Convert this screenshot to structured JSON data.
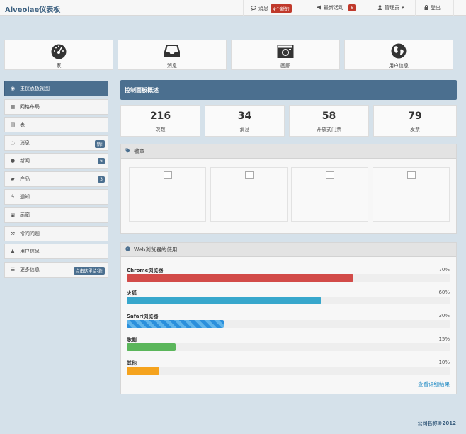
{
  "header": {
    "brand": "Alveolae仪表板",
    "messages_label": "消息",
    "messages_badge": "4个新的",
    "activity_label": "最新活动",
    "activity_badge": "6",
    "admin_label": "管理员",
    "logout_label": "登出"
  },
  "tiles": [
    {
      "icon": "dashboard-icon",
      "label": "家"
    },
    {
      "icon": "inbox-icon",
      "label": "消息"
    },
    {
      "icon": "camera-icon",
      "label": "画廊"
    },
    {
      "icon": "globe-icon",
      "label": "用户信息"
    }
  ],
  "sidebar": {
    "items": [
      {
        "icon": "dashboard-icon",
        "label": "主仪表板视图",
        "badge": ""
      },
      {
        "icon": "grid-icon",
        "label": "网格布局",
        "badge": ""
      },
      {
        "icon": "table-icon",
        "label": "表",
        "badge": ""
      },
      {
        "icon": "comments-icon",
        "label": "消息",
        "badge": "新!"
      },
      {
        "icon": "globe-icon",
        "label": "新闻",
        "badge": "6"
      },
      {
        "icon": "truck-icon",
        "label": "产品",
        "badge": "3"
      },
      {
        "icon": "bolt-icon",
        "label": "通知",
        "badge": ""
      },
      {
        "icon": "picture-icon",
        "label": "画廊",
        "badge": ""
      },
      {
        "icon": "gavel-icon",
        "label": "常问问题",
        "badge": ""
      },
      {
        "icon": "user-icon",
        "label": "用户信息",
        "badge": ""
      },
      {
        "icon": "list-icon",
        "label": "更多信息",
        "badge": "点击这里给我!"
      }
    ]
  },
  "main": {
    "title": "控制面板概述",
    "stats": [
      {
        "value": "216",
        "label": "次数"
      },
      {
        "value": "34",
        "label": "消息"
      },
      {
        "value": "58",
        "label": "开放式门票"
      },
      {
        "value": "79",
        "label": "发票"
      }
    ],
    "badges_title": "徽章",
    "browser_title": "Web浏览器的使用",
    "browsers": [
      {
        "name": "Chrome浏览器",
        "percent": "70%",
        "value": 0.7,
        "color": "#d24b48"
      },
      {
        "name": "火狐",
        "percent": "60%",
        "value": 0.6,
        "color": "#37a7cc"
      },
      {
        "name": "Safari浏览器",
        "percent": "30%",
        "value": 0.3,
        "color": "#2a8fdc"
      },
      {
        "name": "歌剧",
        "percent": "15%",
        "value": 0.15,
        "color": "#5bb65b"
      },
      {
        "name": "其他",
        "percent": "10%",
        "value": 0.1,
        "color": "#f5a31e"
      }
    ],
    "details_link": "查看详细结果"
  },
  "footer": {
    "text": "公司名称©2012"
  }
}
